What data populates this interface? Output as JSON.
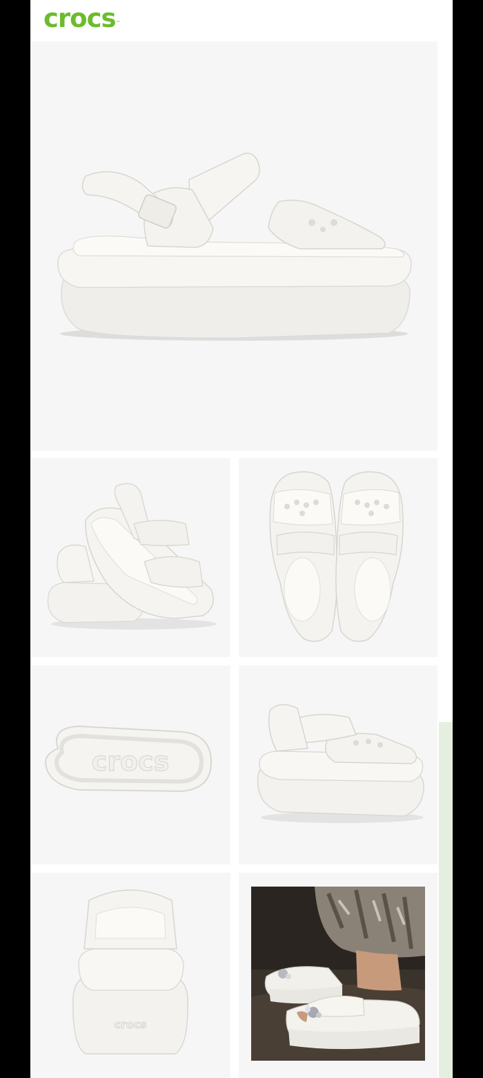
{
  "brand": {
    "logo_text": "crocs",
    "logo_color": "#6cbc2b",
    "trademark": "™"
  },
  "gallery": {
    "images": [
      {
        "name": "side-view",
        "alt": "White platform sandal, side view"
      },
      {
        "name": "pair-angled-view",
        "alt": "Pair of white sandals, angled view"
      },
      {
        "name": "top-view",
        "alt": "Pair of white sandals, top view"
      },
      {
        "name": "outsole-view",
        "alt": "Sandal outsole with crocs lettering"
      },
      {
        "name": "front-angle-view",
        "alt": "White sandal, front angle view"
      },
      {
        "name": "back-view",
        "alt": "White sandal, back view"
      },
      {
        "name": "lifestyle-photo",
        "alt": "Model wearing white sandals with charms"
      }
    ],
    "sole_lettering": "crocs",
    "heel_lettering": "crocs"
  },
  "colors": {
    "product": "#f4f3ef",
    "tile_background": "#f6f6f7",
    "side_accent": "#e4efe0"
  }
}
